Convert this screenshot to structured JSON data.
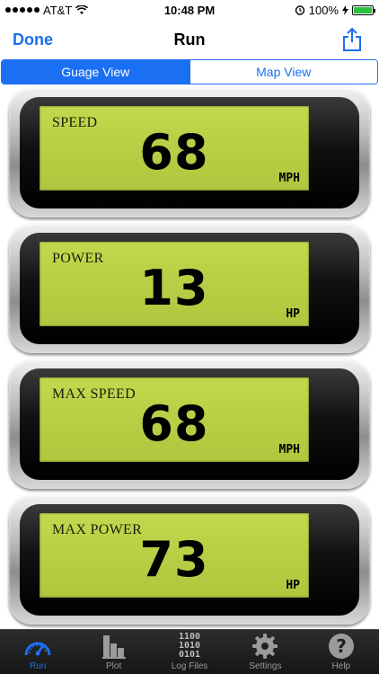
{
  "status": {
    "carrier": "AT&T",
    "time": "10:48 PM",
    "battery": "100%",
    "battery_level": 1.0
  },
  "nav": {
    "done_label": "Done",
    "title": "Run",
    "share_icon": "share-icon"
  },
  "segmented": {
    "options": [
      {
        "label": "Guage View",
        "selected": true
      },
      {
        "label": "Map View",
        "selected": false
      }
    ]
  },
  "gauges": [
    {
      "label": "SPEED",
      "value": "68",
      "unit": "MPH"
    },
    {
      "label": "POWER",
      "value": "13",
      "unit": "HP"
    },
    {
      "label": "MAX SPEED",
      "value": "68",
      "unit": "MPH"
    },
    {
      "label": "MAX POWER",
      "value": "73",
      "unit": "HP"
    }
  ],
  "tabs": [
    {
      "label": "Run",
      "icon": "speedometer-icon",
      "active": true,
      "accent": "#1a6ff3"
    },
    {
      "label": "Plot",
      "icon": "bar-chart-icon",
      "active": false
    },
    {
      "label": "Log Files",
      "icon": "binary-file-icon",
      "active": false,
      "icon_text": [
        "1100",
        "1010",
        "0101"
      ]
    },
    {
      "label": "Settings",
      "icon": "gear-icon",
      "active": false
    },
    {
      "label": "Help",
      "icon": "help-icon",
      "active": false
    }
  ]
}
